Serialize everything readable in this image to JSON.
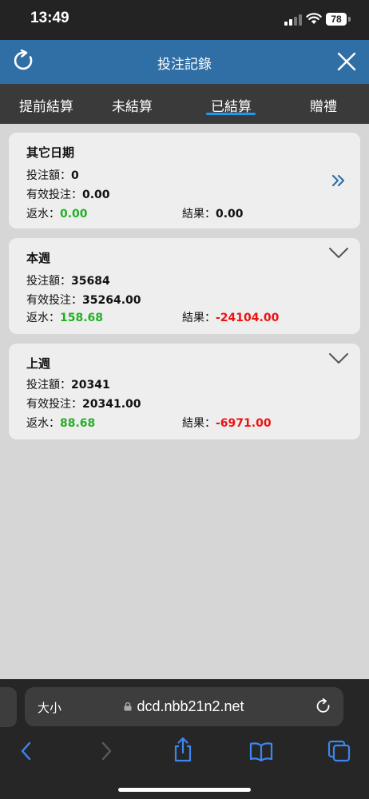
{
  "status_bar": {
    "time": "13:49",
    "battery": "78"
  },
  "header": {
    "title": "投注記錄"
  },
  "tabs": [
    {
      "label": "提前結算",
      "active": false
    },
    {
      "label": "未結算",
      "active": false
    },
    {
      "label": "已結算",
      "active": true
    },
    {
      "label": "贈禮",
      "active": false
    }
  ],
  "labels": {
    "bet_amount": "投注額：",
    "valid_bet": "有效投注：",
    "rebate": "返水：",
    "result": "結果："
  },
  "cards": [
    {
      "title": "其它日期",
      "bet_amount": "0",
      "valid_bet": "0.00",
      "rebate": "0.00",
      "result": "0.00",
      "icon": "double-chevron-right-icon"
    },
    {
      "title": "本週",
      "bet_amount": "35684",
      "valid_bet": "35264.00",
      "rebate": "158.68",
      "result": "-24104.00",
      "icon": "chevron-down-icon"
    },
    {
      "title": "上週",
      "bet_amount": "20341",
      "valid_bet": "20341.00",
      "rebate": "88.68",
      "result": "-6971.00",
      "icon": "chevron-down-icon"
    }
  ],
  "browser": {
    "text_size_label": "大小",
    "url": "dcd.nbb21n2.net"
  },
  "colors": {
    "header_blue": "#2f6fa6",
    "tab_bar": "#3a3a3a",
    "tab_indicator": "#1e9be8",
    "positive_green": "#22b022",
    "negative_red": "#ee1111",
    "ios_blue": "#3b86f0"
  }
}
